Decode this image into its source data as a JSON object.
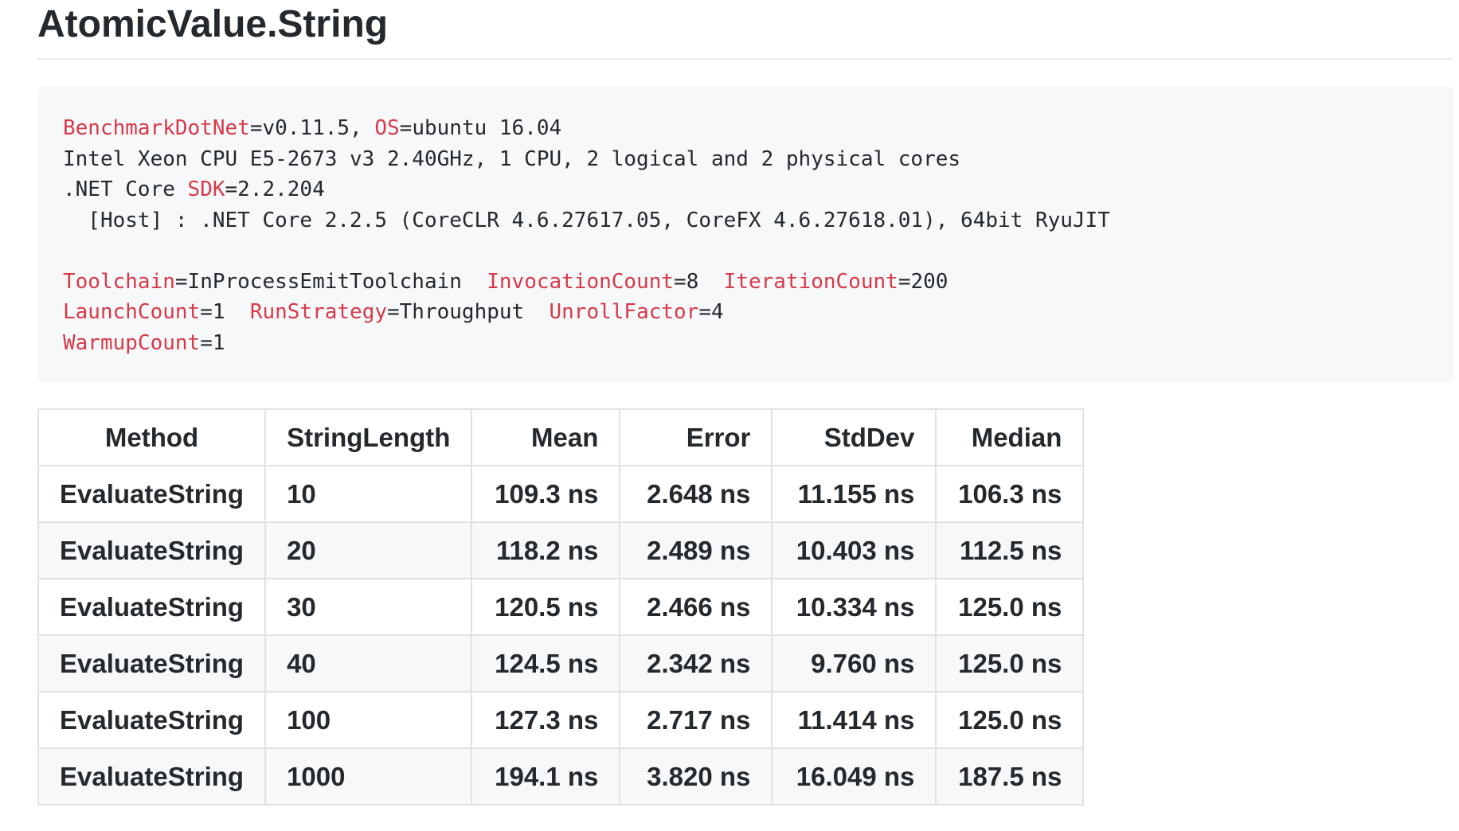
{
  "heading": "AtomicValue.String",
  "code_block": {
    "line1": {
      "k1": "BenchmarkDotNet",
      "v1": "=v0.11.5, ",
      "k2": "OS",
      "v2": "=ubuntu 16.04"
    },
    "line2": "Intel Xeon CPU E5-2673 v3 2.40GHz, 1 CPU, 2 logical and 2 physical cores",
    "line3": {
      "t1": ".NET Core ",
      "k1": "SDK",
      "v1": "=2.2.204"
    },
    "line4": "  [Host] : .NET Core 2.2.5 (CoreCLR 4.6.27617.05, CoreFX 4.6.27618.01), 64bit RyuJIT",
    "line6": {
      "k1": "Toolchain",
      "v1": "=InProcessEmitToolchain  ",
      "k2": "InvocationCount",
      "v2": "=8  ",
      "k3": "IterationCount",
      "v3": "=200"
    },
    "line7": {
      "k1": "LaunchCount",
      "v1": "=1  ",
      "k2": "RunStrategy",
      "v2": "=Throughput  ",
      "k3": "UnrollFactor",
      "v3": "=4"
    },
    "line8": {
      "k1": "WarmupCount",
      "v1": "=1"
    },
    "keyword_color": "#d73a49"
  },
  "table": {
    "headers": [
      "Method",
      "StringLength",
      "Mean",
      "Error",
      "StdDev",
      "Median"
    ],
    "rows": [
      [
        "EvaluateString",
        "10",
        "109.3 ns",
        "2.648 ns",
        "11.155 ns",
        "106.3 ns"
      ],
      [
        "EvaluateString",
        "20",
        "118.2 ns",
        "2.489 ns",
        "10.403 ns",
        "112.5 ns"
      ],
      [
        "EvaluateString",
        "30",
        "120.5 ns",
        "2.466 ns",
        "10.334 ns",
        "125.0 ns"
      ],
      [
        "EvaluateString",
        "40",
        "124.5 ns",
        "2.342 ns",
        "9.760 ns",
        "125.0 ns"
      ],
      [
        "EvaluateString",
        "100",
        "127.3 ns",
        "2.717 ns",
        "11.414 ns",
        "125.0 ns"
      ],
      [
        "EvaluateString",
        "1000",
        "194.1 ns",
        "3.820 ns",
        "16.049 ns",
        "187.5 ns"
      ]
    ]
  }
}
